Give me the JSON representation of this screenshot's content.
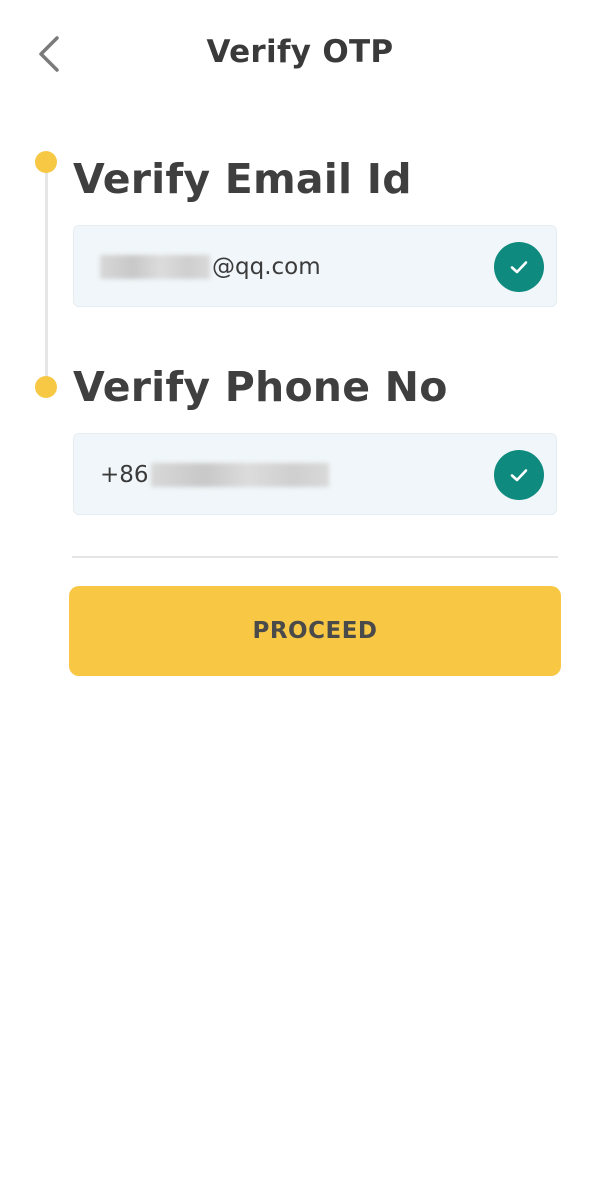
{
  "header": {
    "title": "Verify OTP",
    "back_icon": "chevron-left-icon"
  },
  "steps": [
    {
      "title": "Verify Email Id",
      "value_suffix": "@qq.com",
      "value_masked": true,
      "status_icon": "check-circle-icon",
      "verified": true
    },
    {
      "title": "Verify Phone No",
      "value_prefix": "+86",
      "value_masked": true,
      "status_icon": "check-circle-icon",
      "verified": true
    }
  ],
  "actions": {
    "proceed_label": "PROCEED"
  },
  "colors": {
    "accent": "#f7c844",
    "success": "#0f8a7e",
    "field_bg": "#f0f6f9",
    "text": "#3a3a3a"
  }
}
